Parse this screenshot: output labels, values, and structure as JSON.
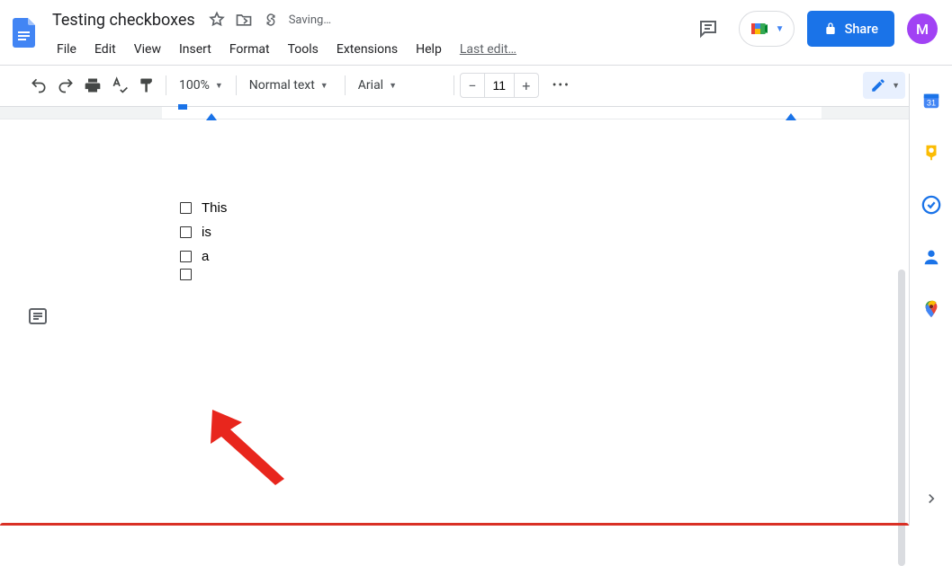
{
  "doc": {
    "title": "Testing checkboxes",
    "saving": "Saving…",
    "last_edit": "Last edit…"
  },
  "menus": {
    "file": "File",
    "edit": "Edit",
    "view": "View",
    "insert": "Insert",
    "format": "Format",
    "tools": "Tools",
    "extensions": "Extensions",
    "help": "Help"
  },
  "toolbar": {
    "zoom": "100%",
    "style": "Normal text",
    "font": "Arial",
    "font_size": "11"
  },
  "share_label": "Share",
  "avatar_letter": "M",
  "checklist": {
    "items": [
      "This",
      "is",
      "a",
      ""
    ]
  }
}
